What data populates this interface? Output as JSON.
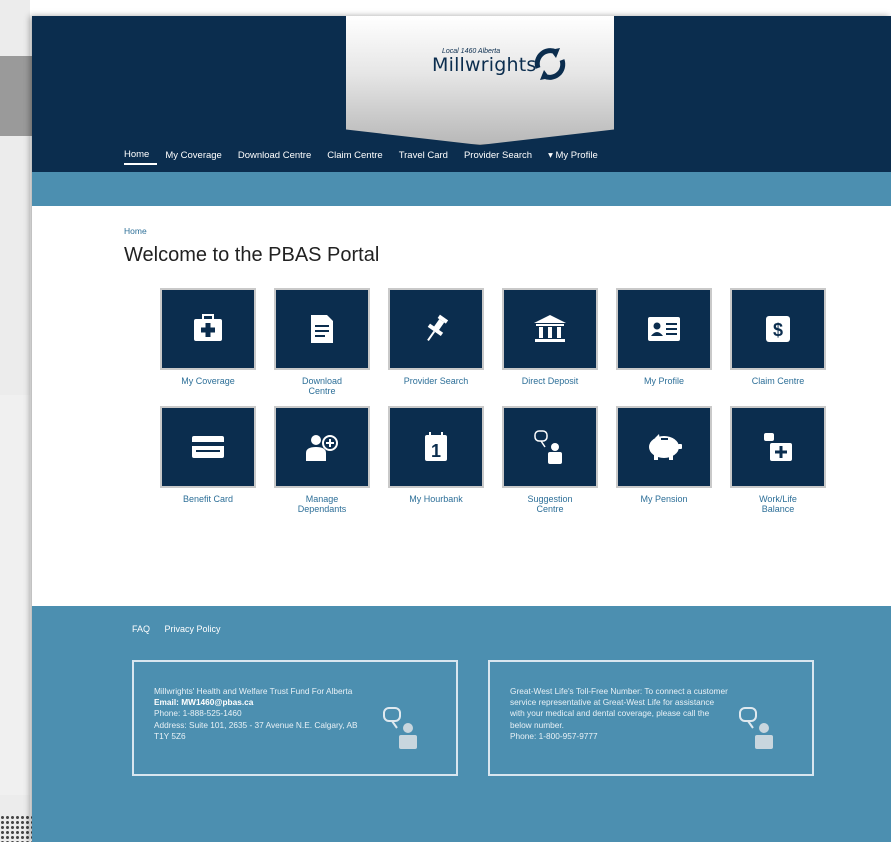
{
  "logo": {
    "small_text": "Local 1460 Alberta",
    "name": "Millwrights"
  },
  "nav": {
    "items": [
      {
        "label": "Home"
      },
      {
        "label": "My Coverage"
      },
      {
        "label": "Download Centre"
      },
      {
        "label": "Claim Centre"
      },
      {
        "label": "Travel Card"
      },
      {
        "label": "Provider Search"
      },
      {
        "label": "▾ My Profile"
      }
    ],
    "active": "Home"
  },
  "breadcrumb": "Home",
  "page_title": "Welcome to the PBAS Portal",
  "tiles": [
    {
      "label": "My Coverage",
      "icon": "medical-kit-icon"
    },
    {
      "label": "Download\nCentre",
      "icon": "document-icon"
    },
    {
      "label": "Provider Search",
      "icon": "pushpin-icon"
    },
    {
      "label": "Direct Deposit",
      "icon": "bank-icon"
    },
    {
      "label": "My Profile",
      "icon": "id-card-icon"
    },
    {
      "label": "Claim Centre",
      "icon": "dollar-icon"
    },
    {
      "label": "Benefit Card",
      "icon": "credit-card-icon"
    },
    {
      "label": "Manage\nDependants",
      "icon": "add-person-icon"
    },
    {
      "label": "My Hourbank",
      "icon": "calendar-icon"
    },
    {
      "label": "Suggestion\nCentre",
      "icon": "speech-person-icon"
    },
    {
      "label": "My Pension",
      "icon": "piggy-bank-icon"
    },
    {
      "label": "Work/Life\nBalance",
      "icon": "briefcase-plus-icon"
    }
  ],
  "footer": {
    "links": [
      "FAQ",
      "Privacy Policy"
    ],
    "box1": {
      "line1": "Millwrights' Health and Welfare Trust Fund For Alberta",
      "email": "Email: MW1460@pbas.ca",
      "phone": "Phone: 1-888-525-1460",
      "address": "Address: Suite 101, 2635 - 37 Avenue N.E. Calgary, AB T1Y 5Z6"
    },
    "box2": {
      "text": "Great-West Life's Toll-Free Number: To connect a customer service representative at Great-West Life for assistance with your medical and dental coverage, please call the below number.",
      "phone": "Phone: 1-800-957-9777"
    }
  },
  "colors": {
    "navy": "#0b2d4e",
    "accent_blue": "#4c8fb0",
    "link_blue": "#2d6f98"
  }
}
